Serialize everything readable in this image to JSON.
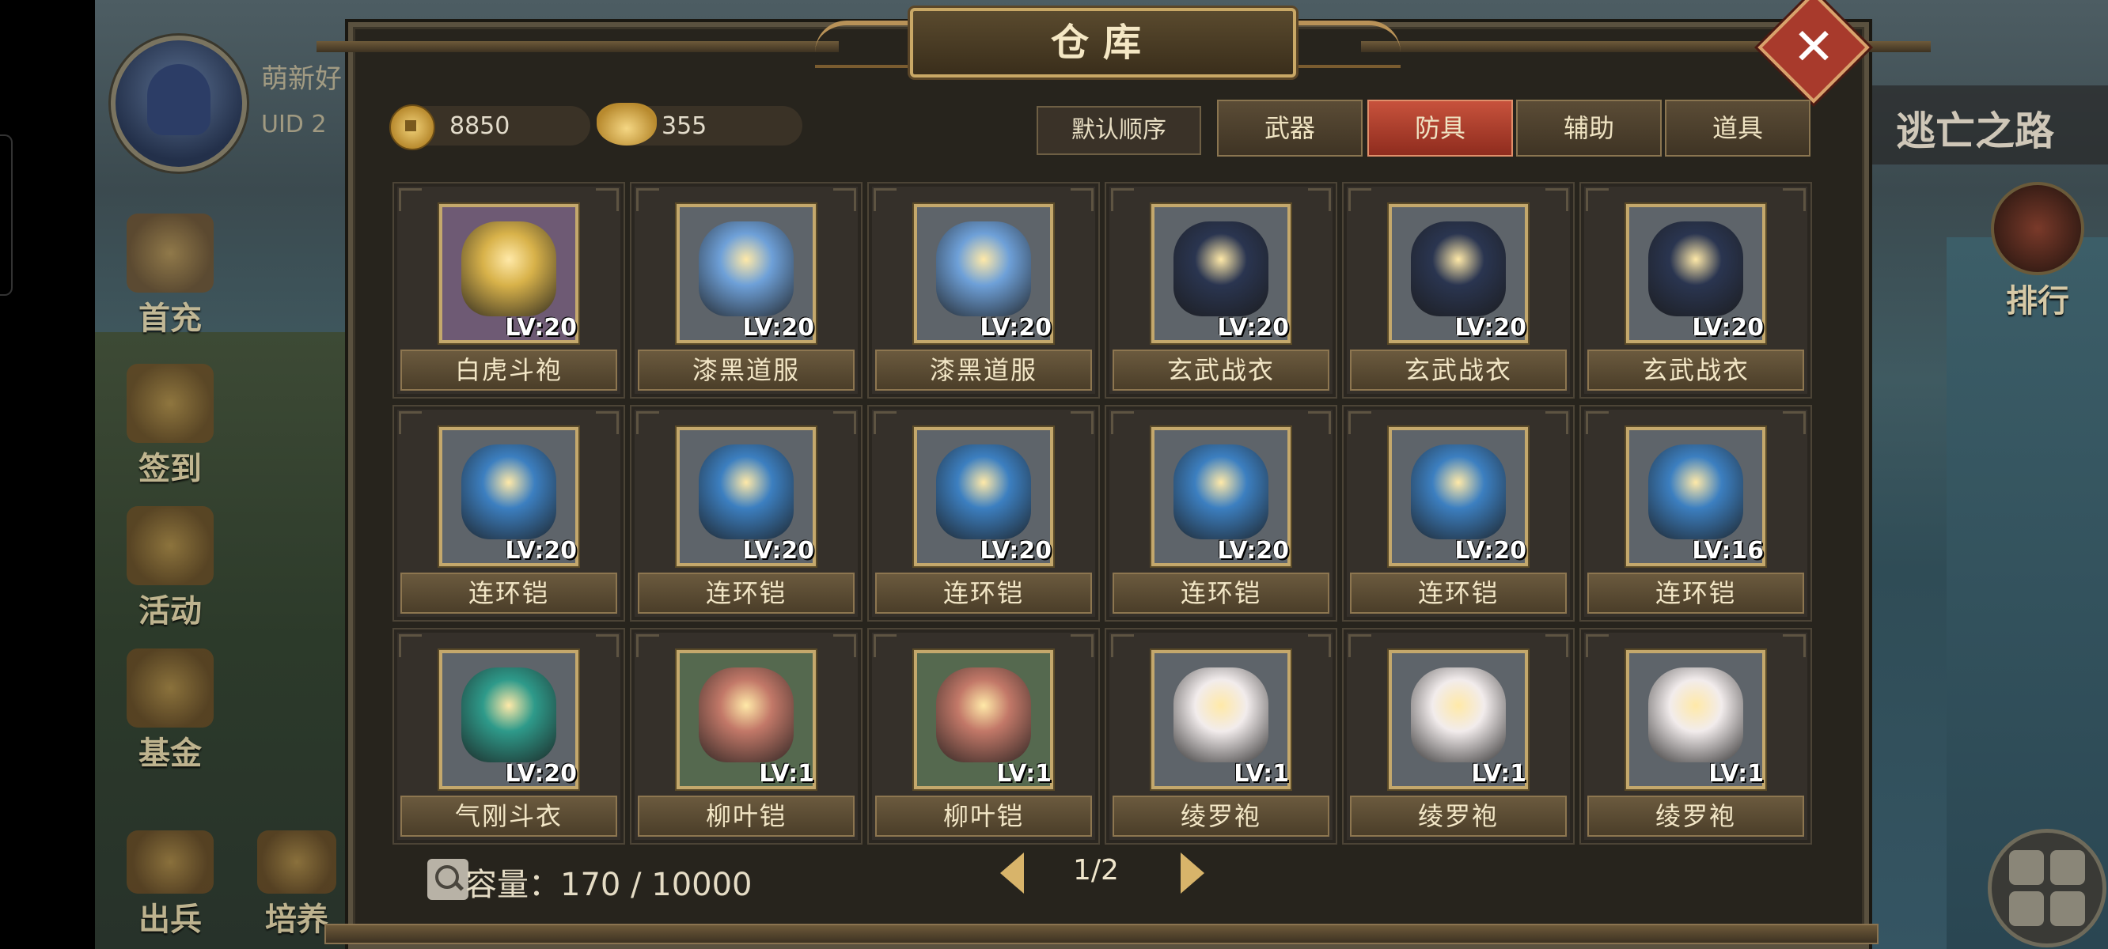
{
  "hud": {
    "player_name": "萌新好",
    "player_uid": "UID  2",
    "left_menu": [
      "首充",
      "签到",
      "活动",
      "基金",
      "出兵",
      "培养"
    ],
    "right_banner": "逃亡之路",
    "rank_label": "排行"
  },
  "panel": {
    "title": "仓库",
    "close_symbol": "✕",
    "currency": {
      "coins": "8850",
      "ingots": "355"
    },
    "sort_label": "默认顺序",
    "tabs": [
      {
        "label": "武器",
        "active": false
      },
      {
        "label": "防具",
        "active": true
      },
      {
        "label": "辅助",
        "active": false
      },
      {
        "label": "道具",
        "active": false
      }
    ],
    "items": [
      {
        "name": "白虎斗袍",
        "lv": "LV:20",
        "color": "#d8b24a",
        "bg": "purple"
      },
      {
        "name": "漆黑道服",
        "lv": "LV:20",
        "color": "#6ea0d8",
        "bg": "gray"
      },
      {
        "name": "漆黑道服",
        "lv": "LV:20",
        "color": "#6ea0d8",
        "bg": "gray"
      },
      {
        "name": "玄武战衣",
        "lv": "LV:20",
        "color": "#2a3550",
        "bg": "gray"
      },
      {
        "name": "玄武战衣",
        "lv": "LV:20",
        "color": "#2a3550",
        "bg": "gray"
      },
      {
        "name": "玄武战衣",
        "lv": "LV:20",
        "color": "#2a3550",
        "bg": "gray"
      },
      {
        "name": "连环铠",
        "lv": "LV:20",
        "color": "#3c7fc0",
        "bg": "gray"
      },
      {
        "name": "连环铠",
        "lv": "LV:20",
        "color": "#3c7fc0",
        "bg": "gray"
      },
      {
        "name": "连环铠",
        "lv": "LV:20",
        "color": "#3c7fc0",
        "bg": "gray"
      },
      {
        "name": "连环铠",
        "lv": "LV:20",
        "color": "#3c7fc0",
        "bg": "gray"
      },
      {
        "name": "连环铠",
        "lv": "LV:20",
        "color": "#3c7fc0",
        "bg": "gray"
      },
      {
        "name": "连环铠",
        "lv": "LV:16",
        "color": "#3c7fc0",
        "bg": "gray"
      },
      {
        "name": "气刚斗衣",
        "lv": "LV:20",
        "color": "#2e9a8a",
        "bg": "gray"
      },
      {
        "name": "柳叶铠",
        "lv": "LV:1",
        "color": "#c27868",
        "bg": "green"
      },
      {
        "name": "柳叶铠",
        "lv": "LV:1",
        "color": "#c27868",
        "bg": "green"
      },
      {
        "name": "绫罗袍",
        "lv": "LV:1",
        "color": "#f2ecec",
        "bg": "gray"
      },
      {
        "name": "绫罗袍",
        "lv": "LV:1",
        "color": "#f2ecec",
        "bg": "gray"
      },
      {
        "name": "绫罗袍",
        "lv": "LV:1",
        "color": "#f2ecec",
        "bg": "gray"
      }
    ],
    "capacity": "容量：170 / 10000",
    "page": "1/2"
  }
}
